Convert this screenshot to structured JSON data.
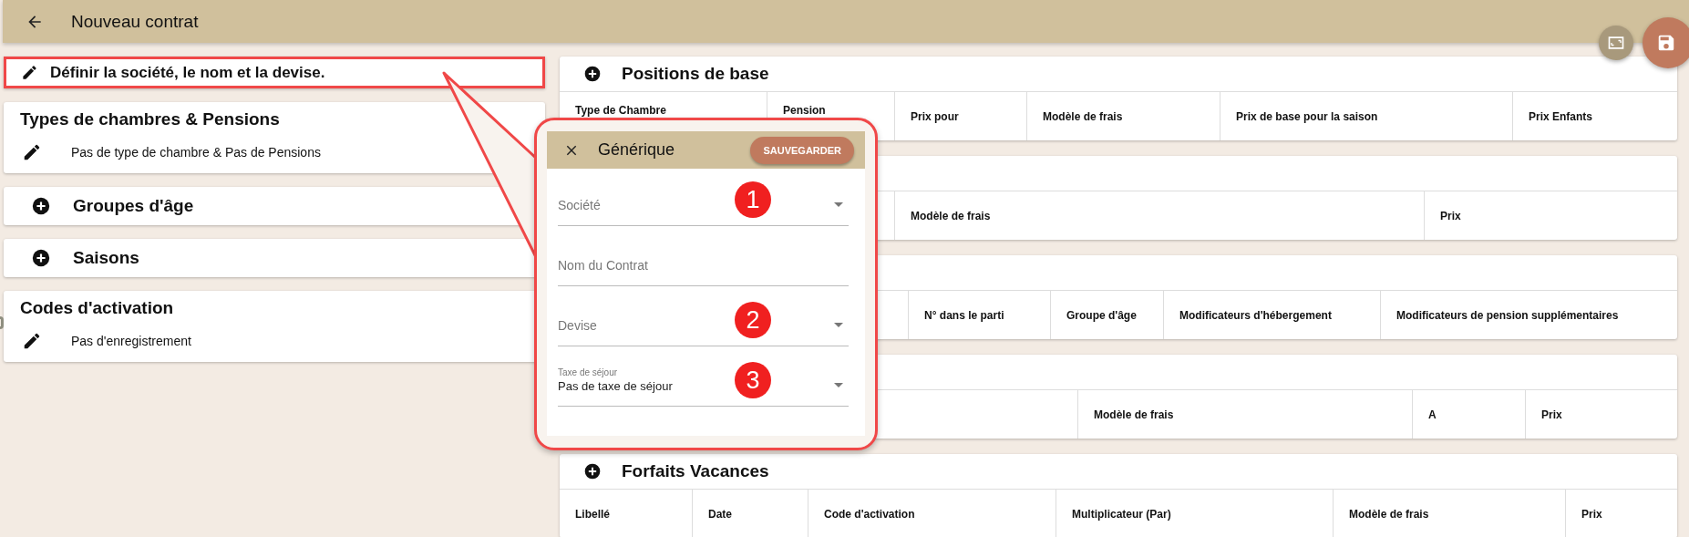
{
  "app_bar": {
    "title": "Nouveau contrat"
  },
  "summary_cards": [
    {
      "kind": "highlight",
      "title": "Définir la société, le nom et la devise."
    },
    {
      "kind": "detail",
      "title": "Types de chambres & Pensions",
      "line": "Pas de type de chambre & Pas de Pensions"
    },
    {
      "kind": "add",
      "title": "Groupes d'âge"
    },
    {
      "kind": "add",
      "title": "Saisons"
    },
    {
      "kind": "detail",
      "title": "Codes d'activation",
      "line": "Pas d'enregistrement"
    }
  ],
  "sections": [
    {
      "title": "Positions de base",
      "columns": [
        "Type de Chambre",
        "Pension",
        "Prix pour",
        "Modèle de frais",
        "Prix de base pour la saison",
        "Prix Enfants"
      ]
    },
    {
      "columns": [
        "Modèle de frais",
        "Prix"
      ]
    },
    {
      "columns": [
        "N° dans le parti",
        "Groupe d'âge",
        "Modificateurs d'hébergement",
        "Modificateurs de pension supplémentaires"
      ]
    },
    {
      "columns": [
        "Modèle de frais",
        "A",
        "Prix"
      ]
    },
    {
      "title": "Forfaits Vacances",
      "columns": [
        "Libellé",
        "Date",
        "Code d'activation",
        "Multiplicateur (Par)",
        "Modèle de frais",
        "Prix"
      ]
    }
  ],
  "dialog": {
    "title": "Générique",
    "save_button": "SAUVEGARDER",
    "fields": [
      {
        "kind": "select",
        "placeholder": "Société",
        "step": "1"
      },
      {
        "kind": "text",
        "placeholder": "Nom du Contrat"
      },
      {
        "kind": "select",
        "placeholder": "Devise",
        "step": "2"
      },
      {
        "kind": "select",
        "label": "Taxe de séjour",
        "value": "Pas de taxe de séjour",
        "step": "3"
      }
    ]
  }
}
